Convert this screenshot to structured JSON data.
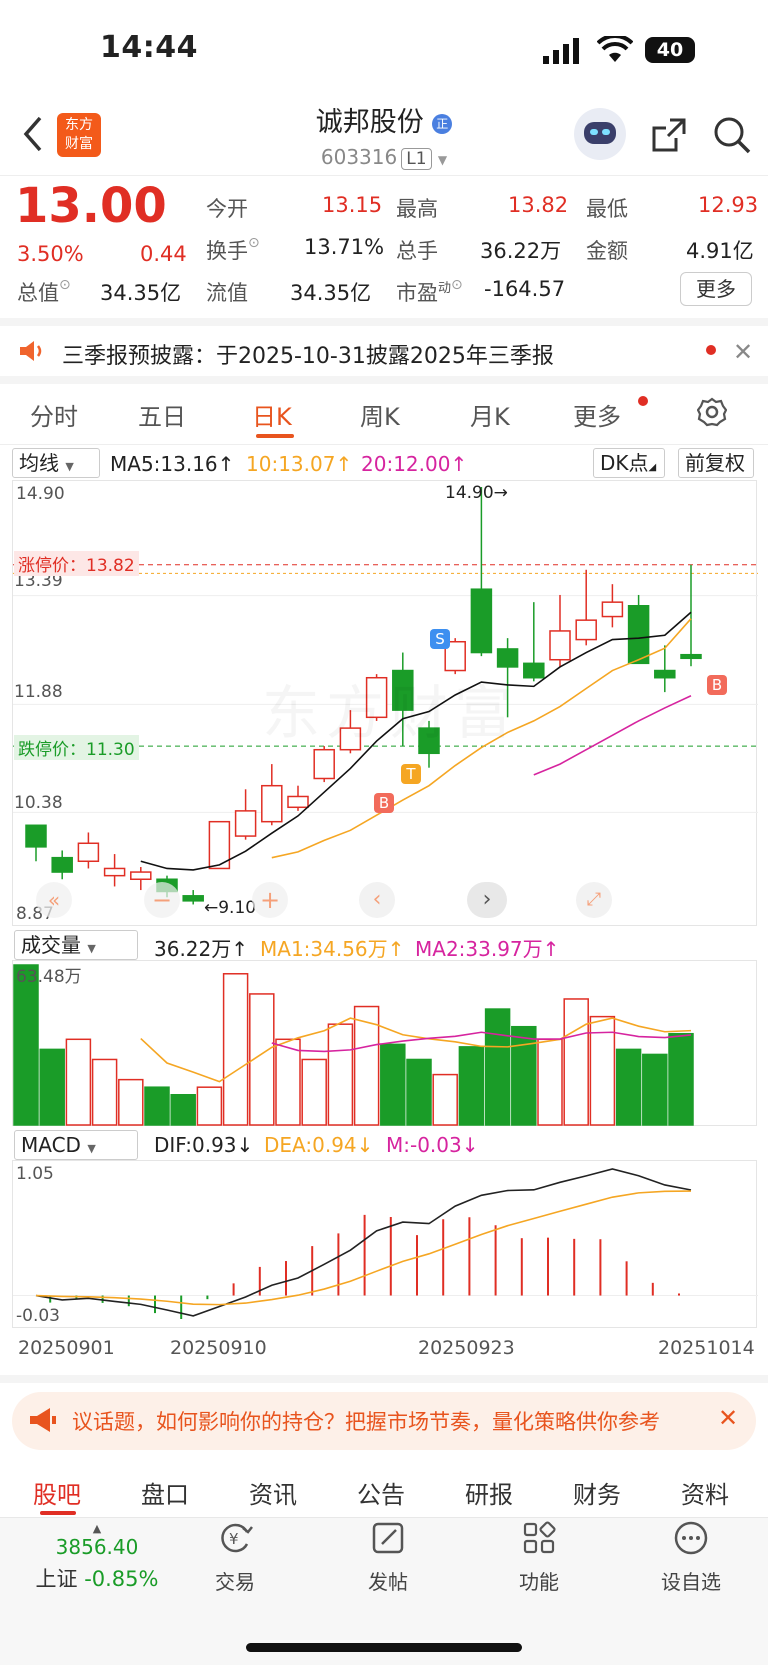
{
  "status_bar": {
    "time": "14:44",
    "battery": "40"
  },
  "header": {
    "logo_line1": "东方",
    "logo_line2": "财富",
    "title": "诚邦股份",
    "title_badge": "正",
    "code": "603316",
    "level": "L1"
  },
  "quote": {
    "price": "13.00",
    "change_pct": "3.50%",
    "change": "0.44",
    "open_label": "今开",
    "open": "13.15",
    "high_label": "最高",
    "high": "13.82",
    "low_label": "最低",
    "low": "12.93",
    "turnover_label": "换手",
    "turnover": "13.71%",
    "volume_label": "总手",
    "volume": "36.22万",
    "amount_label": "金额",
    "amount": "4.91亿",
    "mktcap_label": "总值",
    "mktcap": "34.35亿",
    "float_label": "流值",
    "float_val": "34.35亿",
    "pe_label": "市盈",
    "pe_sup": "动",
    "pe": "-164.57",
    "more": "更多"
  },
  "notice": {
    "text": "三季报预披露：于2025-10-31披露2025年三季报"
  },
  "tabs": [
    "分时",
    "五日",
    "日K",
    "周K",
    "月K",
    "更多"
  ],
  "kline": {
    "ma_select": "均线",
    "ma5": "MA5:13.16↑",
    "ma10": "10:13.07↑",
    "ma20": "20:12.00↑",
    "dk": "DK点",
    "adjust": "前复权",
    "y_labels": [
      "14.90",
      "13.39",
      "11.88",
      "10.38",
      "8.87"
    ],
    "limit_up": "涨停价：13.82",
    "limit_down": "跌停价：11.30",
    "high_marker": "14.90→",
    "low_marker": "←9.10",
    "sig_s": "S",
    "sig_t": "T",
    "sig_b": "B"
  },
  "volume": {
    "select": "成交量",
    "vol": "36.22万↑",
    "ma1": "MA1:34.56万↑",
    "ma2": "MA2:33.97万↑",
    "max_label": "63.48万"
  },
  "macd": {
    "select": "MACD",
    "dif": "DIF:0.93↓",
    "dea": "DEA:0.94↓",
    "m": "M:-0.03↓",
    "top": "1.05",
    "bottom": "-0.03"
  },
  "x_dates": [
    "20250901",
    "20250910",
    "20250923",
    "20251014"
  ],
  "banner": {
    "text": "议话题，如何影响你的持仓？把握市场节奏，量化策略供你参考"
  },
  "bottom_tabs": [
    "股吧",
    "盘口",
    "资讯",
    "公告",
    "研报",
    "财务",
    "资料"
  ],
  "footer": {
    "index_value": "3856.40",
    "index_name": "上证",
    "index_change": "-0.85%",
    "items": [
      "交易",
      "发帖",
      "功能",
      "设自选"
    ]
  },
  "colors": {
    "up": "#e02e24",
    "down": "#1a9c28",
    "accent": "#e8541e",
    "ma10": "#f5a623",
    "ma20": "#d6249f"
  },
  "chart_data": {
    "type": "candlestick",
    "x": [
      "0901",
      "0902",
      "0903",
      "0904",
      "0905",
      "0908",
      "0909",
      "0910",
      "0911",
      "0912",
      "0915",
      "0916",
      "0917",
      "0918",
      "0919",
      "0922",
      "0923",
      "0924",
      "0925",
      "0926",
      "0929",
      "0930",
      "1009",
      "1010",
      "1013",
      "1014"
    ],
    "open": [
      10.2,
      9.75,
      9.7,
      9.5,
      9.45,
      9.45,
      9.22,
      9.6,
      10.05,
      10.25,
      10.45,
      10.85,
      11.25,
      11.7,
      12.35,
      11.55,
      12.35,
      13.48,
      12.65,
      12.45,
      12.5,
      12.78,
      13.1,
      13.25,
      12.35,
      12.57
    ],
    "close": [
      9.9,
      9.55,
      9.95,
      9.6,
      9.55,
      9.28,
      9.15,
      10.25,
      10.4,
      10.75,
      10.6,
      11.25,
      11.55,
      12.25,
      11.8,
      11.2,
      12.75,
      12.6,
      12.4,
      12.25,
      12.9,
      13.05,
      13.3,
      12.45,
      12.25,
      12.52
    ],
    "high": [
      10.2,
      9.85,
      10.1,
      9.8,
      9.62,
      9.5,
      9.3,
      10.25,
      10.7,
      11.05,
      10.75,
      11.3,
      11.8,
      12.3,
      12.6,
      11.65,
      12.8,
      14.9,
      12.8,
      13.3,
      13.4,
      13.75,
      13.55,
      13.4,
      12.7,
      13.82
    ],
    "low": [
      9.7,
      9.45,
      9.6,
      9.35,
      9.3,
      9.2,
      9.1,
      9.6,
      10.0,
      10.2,
      10.4,
      10.8,
      11.2,
      11.65,
      11.3,
      11.0,
      12.3,
      12.55,
      11.7,
      12.2,
      12.4,
      12.7,
      12.95,
      12.5,
      12.05,
      12.41
    ],
    "volume": [
      63.48,
      30,
      34,
      26,
      18,
      15,
      12,
      15,
      60,
      52,
      34,
      26,
      40,
      47,
      32,
      26,
      20,
      31,
      46,
      39,
      34,
      50,
      43,
      30,
      28,
      36.22
    ],
    "ma5": [
      null,
      null,
      null,
      null,
      9.7,
      9.6,
      9.58,
      9.65,
      9.84,
      10.09,
      10.33,
      10.66,
      10.99,
      11.37,
      11.68,
      11.78,
      12.01,
      12.19,
      12.15,
      12.13,
      12.4,
      12.6,
      12.78,
      12.8,
      12.84,
      13.16
    ],
    "ma10": [
      null,
      null,
      null,
      null,
      null,
      null,
      null,
      null,
      null,
      9.75,
      9.83,
      9.99,
      10.13,
      10.34,
      10.55,
      10.75,
      11.03,
      11.28,
      11.49,
      11.65,
      11.85,
      12.1,
      12.35,
      12.5,
      12.66,
      13.07
    ],
    "ma20": [
      null,
      null,
      null,
      null,
      null,
      null,
      null,
      null,
      null,
      null,
      null,
      null,
      null,
      null,
      null,
      null,
      null,
      null,
      null,
      10.9,
      11.05,
      11.25,
      11.45,
      11.65,
      11.83,
      12.0
    ],
    "ylim": [
      8.87,
      14.9
    ]
  }
}
